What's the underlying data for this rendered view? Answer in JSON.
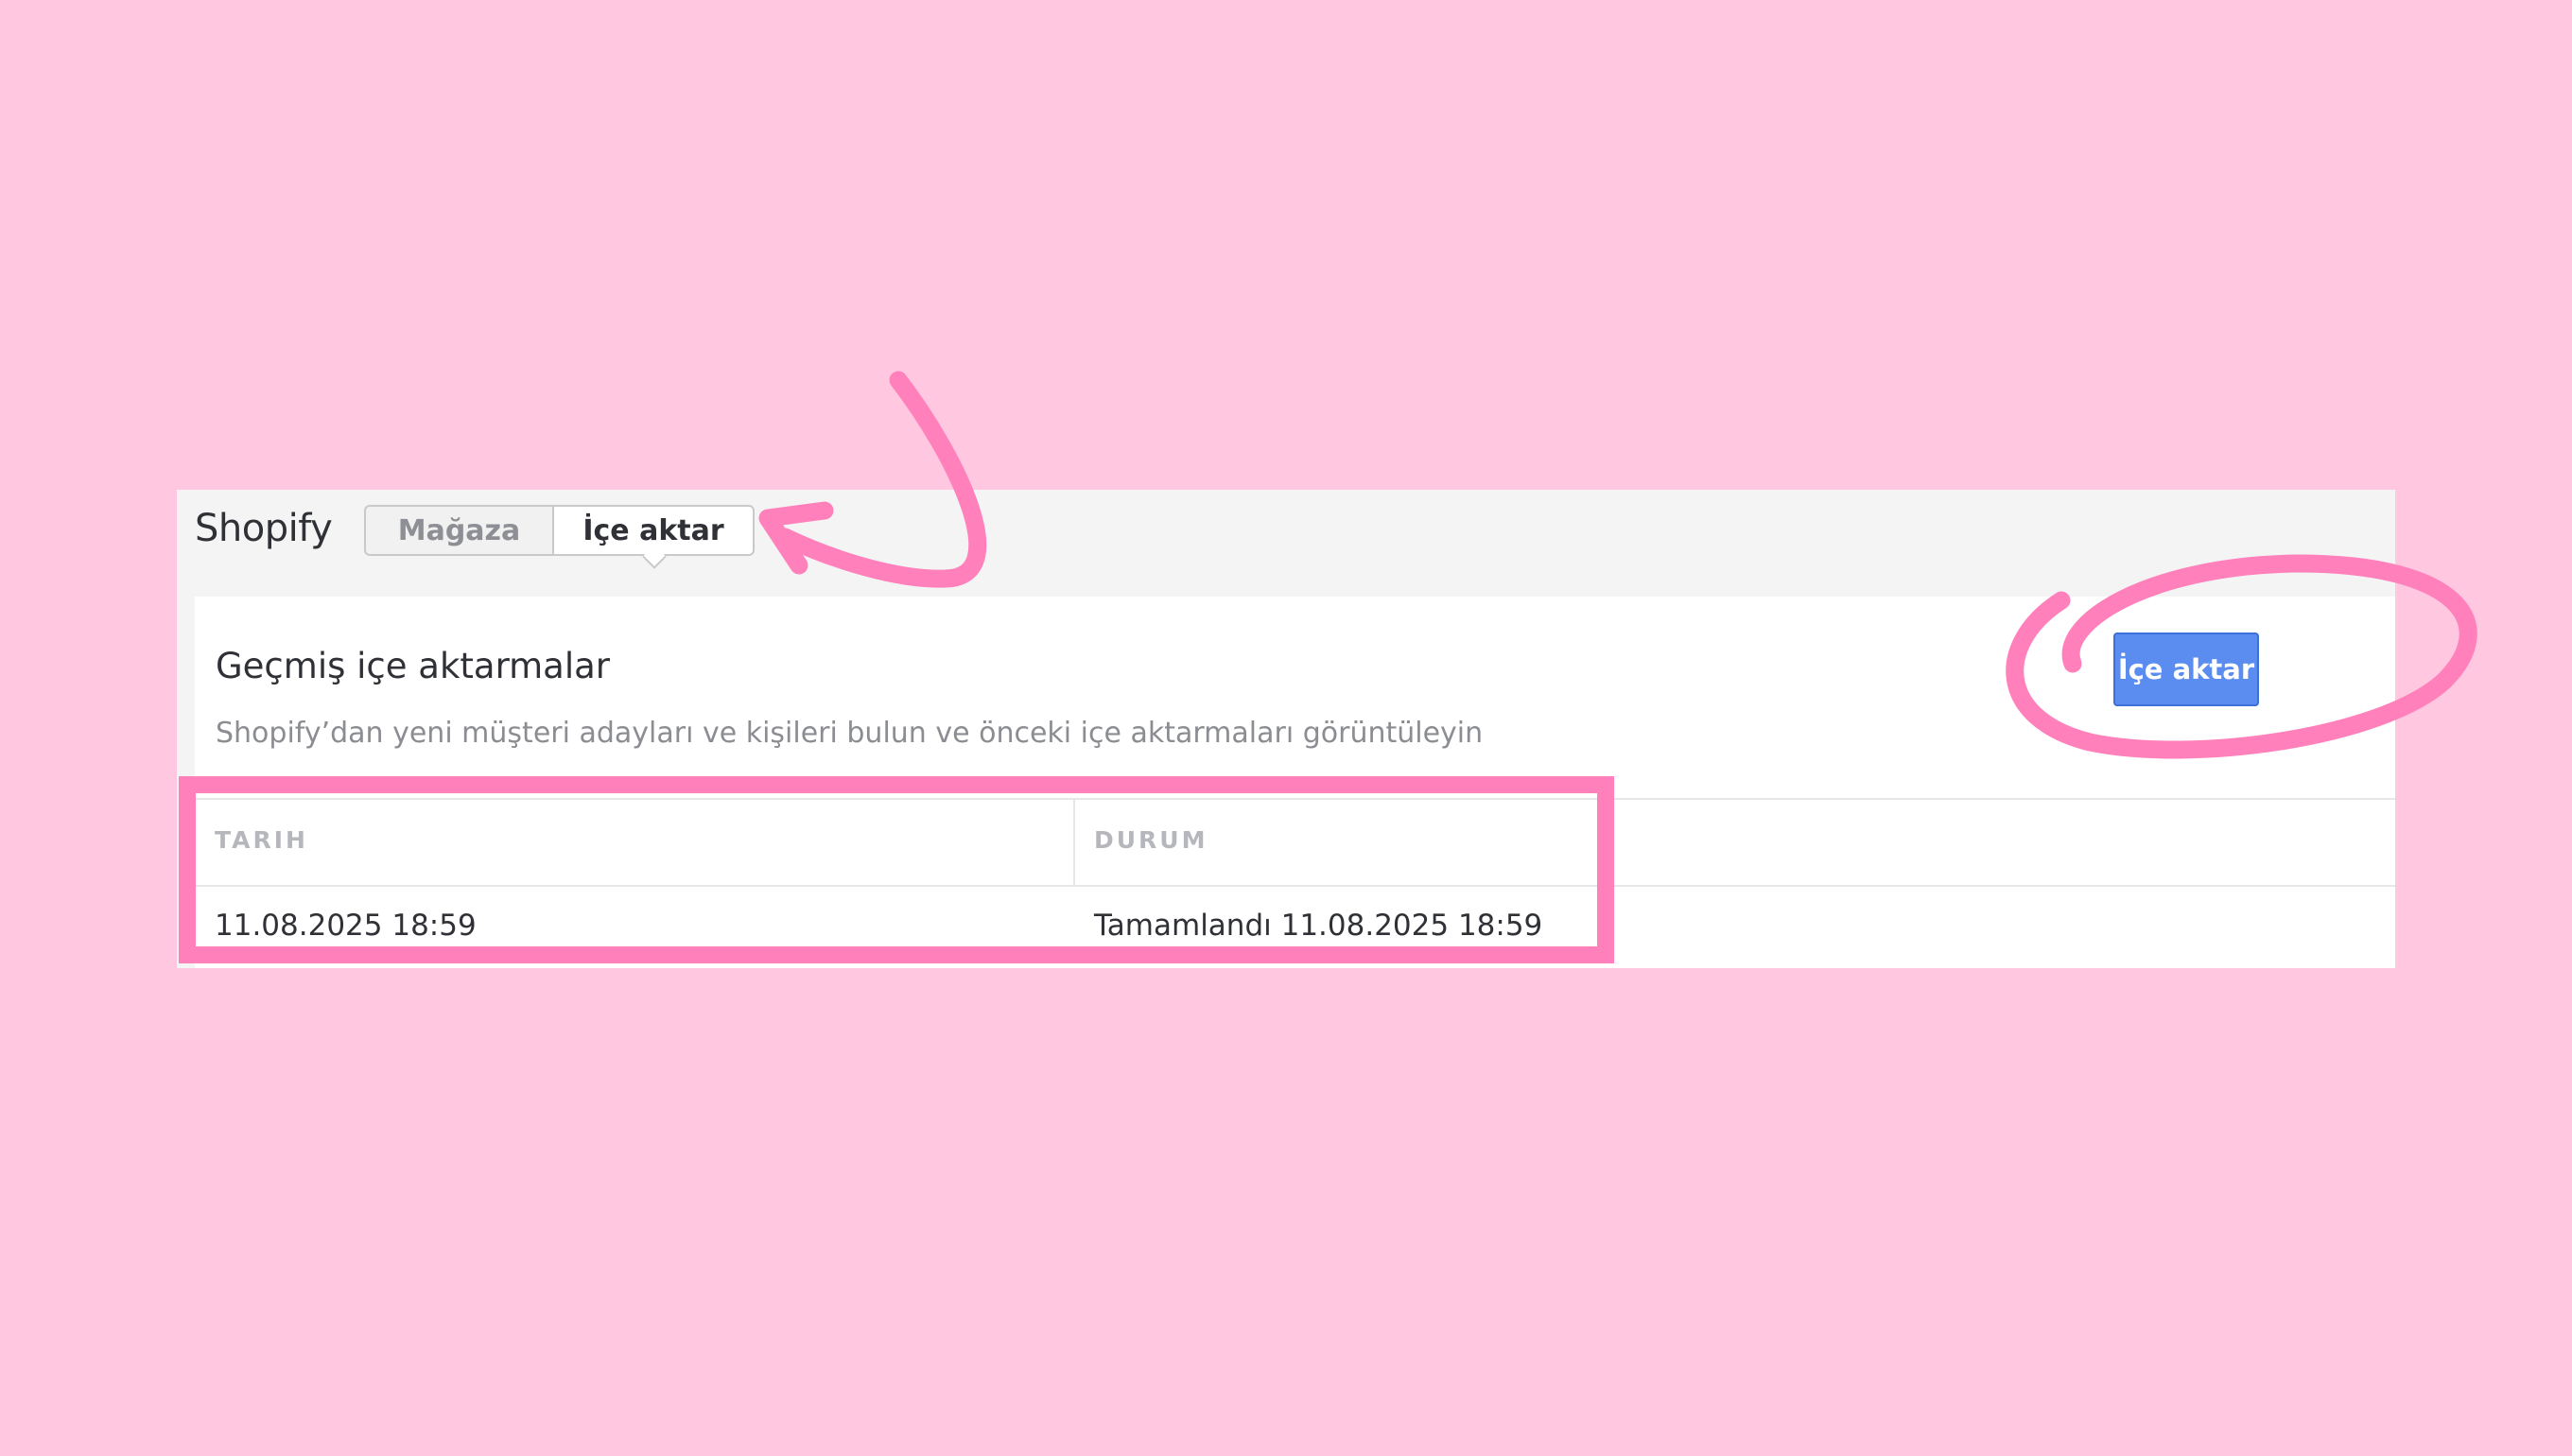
{
  "app": {
    "brand": "Shopify"
  },
  "tabs": [
    {
      "label": "Mağaza",
      "active": false
    },
    {
      "label": "İçe aktar",
      "active": true
    }
  ],
  "card": {
    "title": "Geçmiş içe aktarmalar",
    "description": "Shopify’dan yeni müşteri adayları ve kişileri bulun ve önceki içe aktarmaları görüntüleyin",
    "import_button": "İçe aktar"
  },
  "table": {
    "columns": [
      "TARIH",
      "DURUM"
    ],
    "rows": [
      {
        "date": "11.08.2025 18:59",
        "status": "Tamamlandı 11.08.2025 18:59"
      }
    ]
  },
  "colors": {
    "background": "#ffc8e0",
    "annotation": "#ff80ba",
    "button": "#5b8cef"
  }
}
